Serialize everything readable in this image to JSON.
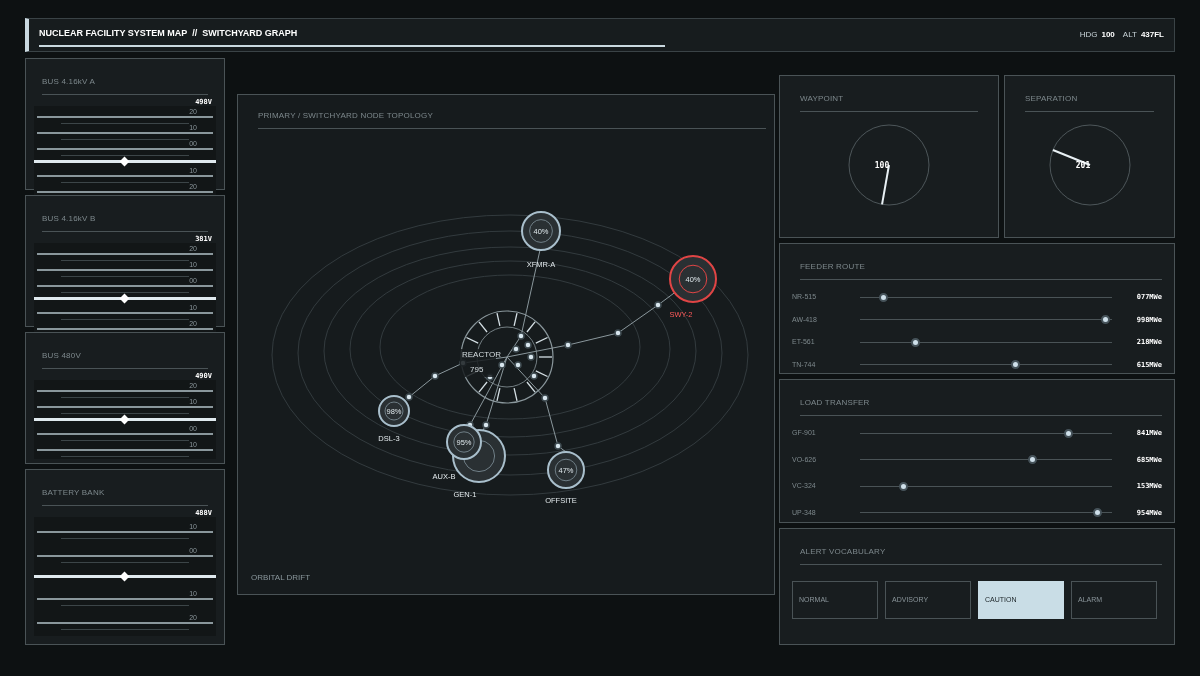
{
  "header": {
    "title": "NUCLEAR FACILITY SYSTEM MAP  //  SWITCHYARD GRAPH",
    "readouts": [
      {
        "label": "HDG",
        "value": "100"
      },
      {
        "label": "ALT",
        "value": "437FL"
      }
    ]
  },
  "bus_panels": [
    {
      "title": "BUS 4.16kV A",
      "reading": "498V",
      "ticks": [
        "20",
        "10",
        "00",
        "10",
        "20"
      ],
      "level": 0.5
    },
    {
      "title": "BUS 4.16kV B",
      "reading": "381V",
      "ticks": [
        "20",
        "10",
        "00",
        "10",
        "20"
      ],
      "level": 0.5
    },
    {
      "title": "BUS 480V",
      "reading": "490V",
      "ticks": [
        "20",
        "10",
        "00",
        "10"
      ],
      "level": 0.5
    },
    {
      "title": "BATTERY BANK",
      "reading": "488V",
      "ticks": [
        "10",
        "00",
        "10",
        "20"
      ],
      "level": 0.5
    }
  ],
  "topology": {
    "title": "PRIMARY / SWITCHYARD NODE TOPOLOGY",
    "footer": "ORBITAL DRIFT",
    "hub": {
      "label": "REACTOR",
      "value": "795"
    },
    "nodes": [
      {
        "label": "XFMR-A",
        "percent": "40%",
        "alert": false
      },
      {
        "label": "SWY-2",
        "percent": "40%",
        "alert": true
      },
      {
        "label": "DSL-3",
        "percent": "98%",
        "alert": false
      },
      {
        "label": "GEN-1",
        "alert": false
      },
      {
        "label": "AUX-B",
        "percent": "95%",
        "alert": false
      },
      {
        "label": "OFFSITE",
        "percent": "47%",
        "alert": false
      }
    ]
  },
  "dials": [
    {
      "title": "WAYPOINT",
      "value": "100"
    },
    {
      "title": "SEPARATION",
      "value": "201"
    }
  ],
  "slider_panels": [
    {
      "title": "FEEDER ROUTE",
      "rows": [
        {
          "label": "NR-515",
          "level": 0.08,
          "reading": "077MWe"
        },
        {
          "label": "AW-418",
          "level": 0.99,
          "reading": "998MWe"
        },
        {
          "label": "ET-561",
          "level": 0.21,
          "reading": "218MWe"
        },
        {
          "label": "TN-744",
          "level": 0.62,
          "reading": "615MWe"
        }
      ]
    },
    {
      "title": "LOAD TRANSFER",
      "rows": [
        {
          "label": "GF-901",
          "level": 0.84,
          "reading": "841MWe"
        },
        {
          "label": "VO-626",
          "level": 0.69,
          "reading": "685MWe"
        },
        {
          "label": "VC-324",
          "level": 0.16,
          "reading": "153MWe"
        },
        {
          "label": "UP-348",
          "level": 0.96,
          "reading": "954MWe"
        }
      ]
    }
  ],
  "alert_vocabulary": {
    "title": "ALERT VOCABULARY",
    "items": [
      {
        "label": "NORMAL",
        "selected": false
      },
      {
        "label": "ADVISORY",
        "selected": false
      },
      {
        "label": "CAUTION",
        "selected": true
      },
      {
        "label": "ALARM",
        "selected": false
      }
    ]
  }
}
